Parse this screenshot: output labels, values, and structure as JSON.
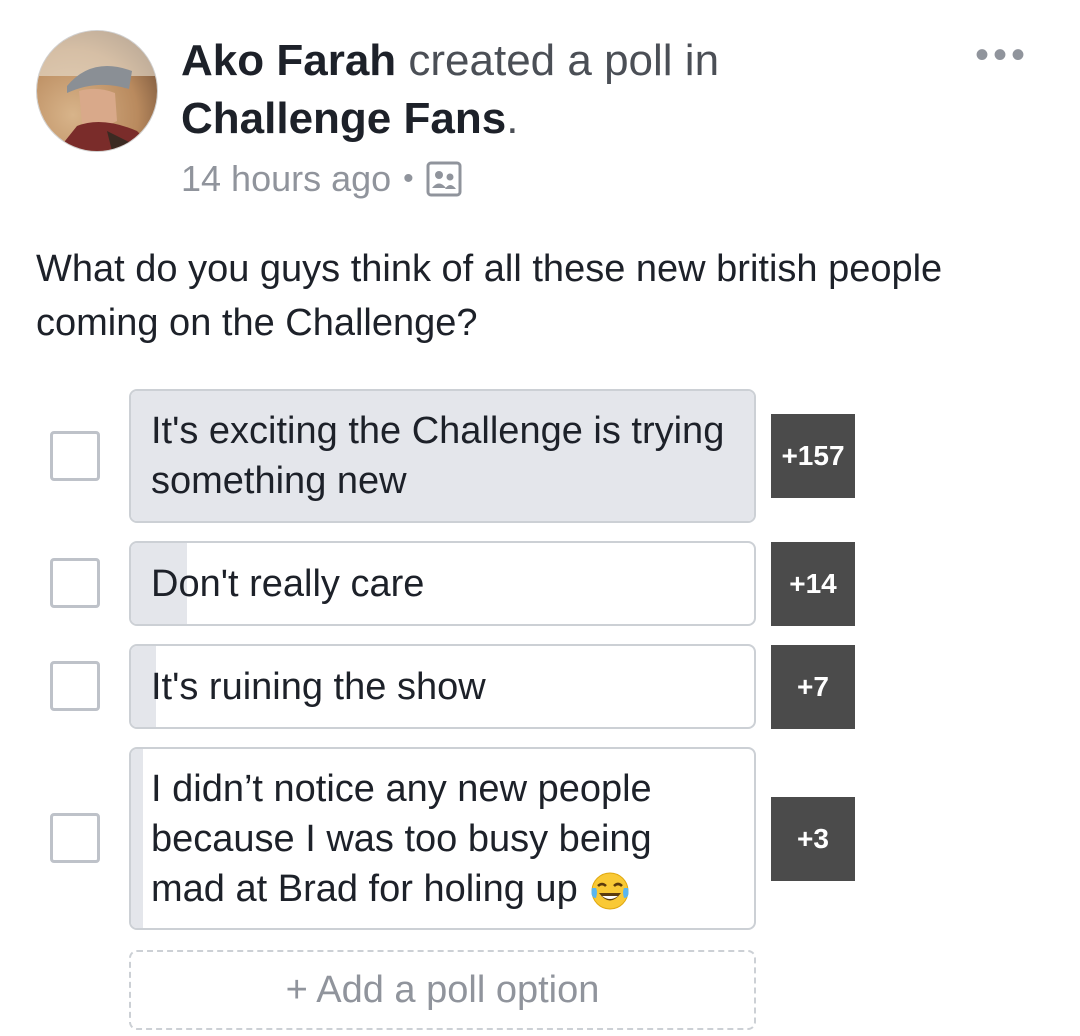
{
  "post": {
    "author": "Ako Farah",
    "action": " created a poll in",
    "group": "Challenge Fans",
    "period": ".",
    "time": "14 hours ago",
    "separator": "•",
    "audience_icon": "group-audience-icon",
    "more_label": "•••",
    "question": "What do you guys think of all these new british people coming on the Challenge?"
  },
  "poll": {
    "options": [
      {
        "label": "It's exciting the Challenge is trying something new",
        "count": "+157",
        "fill_percent": 100
      },
      {
        "label": "Don't really care",
        "count": "+14",
        "fill_percent": 9
      },
      {
        "label": "It's ruining the show",
        "count": "+7",
        "fill_percent": 4
      },
      {
        "label": "I didn’t notice any new people because I was too busy being mad at Brad for holing up",
        "count": "+3",
        "emoji": "face-with-tears-of-joy",
        "fill_percent": 2
      }
    ],
    "add_option_label": "+ Add a poll option"
  },
  "colors": {
    "fill": "#e4e6eb",
    "count_bg": "#4b4b4b",
    "muted_text": "#90949c"
  }
}
